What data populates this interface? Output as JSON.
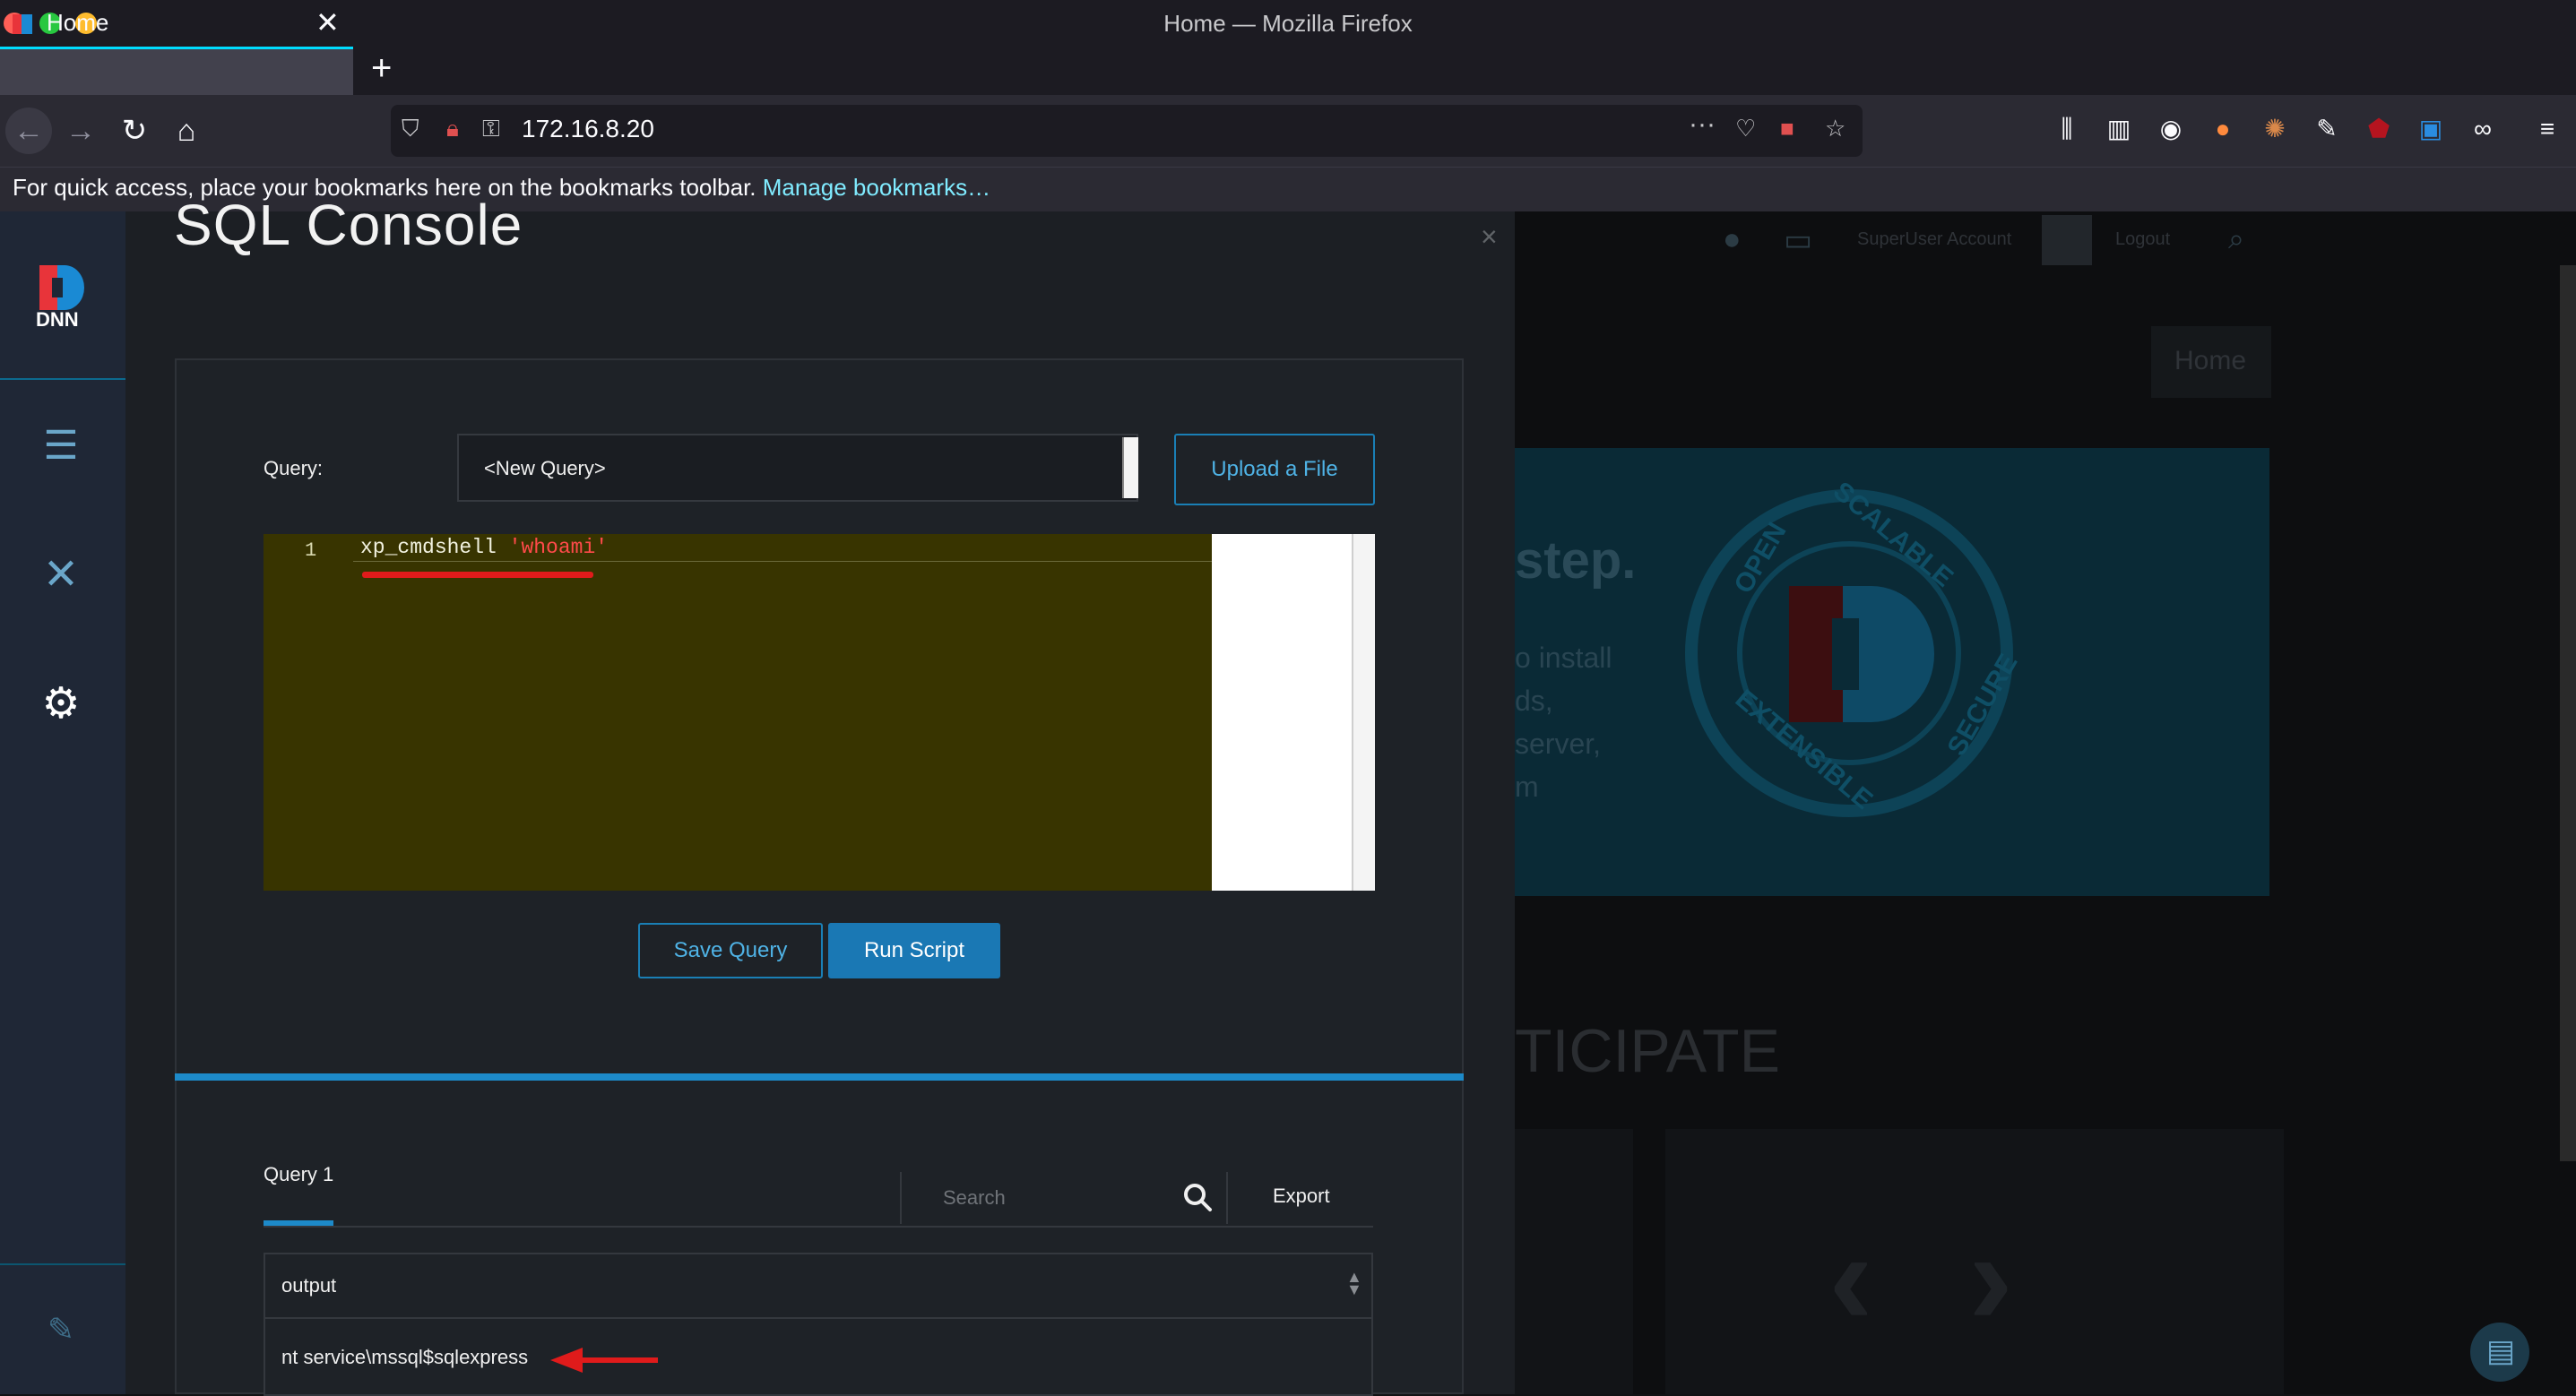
{
  "browser": {
    "window_title": "Home — Mozilla Firefox",
    "tab_title": "Home",
    "tab_close": "✕",
    "new_tab": "+",
    "url": "172.16.8.20",
    "url_more": "···",
    "bookmarks_message": "For quick access, place your bookmarks here on the bookmarks toolbar.",
    "bookmarks_link": "Manage bookmarks…"
  },
  "sidebar": {
    "logo_text": "DNN"
  },
  "console": {
    "title": "SQL Console",
    "close": "×",
    "query_label": "Query:",
    "query_select_value": "<New Query>",
    "upload_button": "Upload a File",
    "editor": {
      "line_number": "1",
      "code_keyword": "xp_cmdshell",
      "code_string": "'whoami'"
    },
    "save_button": "Save Query",
    "run_button": "Run Script"
  },
  "results": {
    "tab_label": "Query 1",
    "search_placeholder": "Search",
    "export_label": "Export",
    "column_header": "output",
    "row_value": "nt service\\mssql$sqlexpress"
  },
  "site": {
    "topbar_user": "SuperUser Account",
    "topbar_logout": "Logout",
    "nav_home": "Home",
    "hero_heading": "step.",
    "hero_lines": [
      "o install",
      "ds,",
      "server,",
      "m"
    ],
    "section_heading": "TICIPATE",
    "seal_words": [
      "OPEN",
      "SCALABLE",
      "EXTENSIBLE",
      "SECURE"
    ]
  },
  "colors": {
    "accent": "#1d8ac9",
    "editor_bg": "#383400",
    "annotation_red": "#e01b1b"
  }
}
